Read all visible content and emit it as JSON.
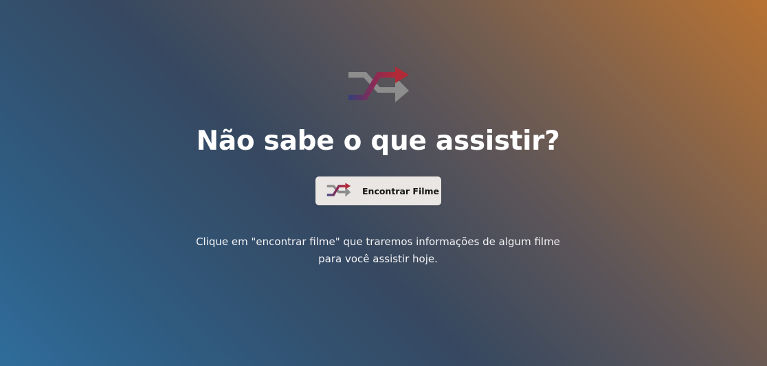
{
  "hero": {
    "title": "Não sabe o que assistir?",
    "description": "Clique em \"encontrar filme\" que traremos informações de algum filme para você assistir hoje.",
    "logo_icon": "shuffle-icon"
  },
  "action": {
    "button_label": "Encontrar Filme",
    "button_icon": "shuffle-icon"
  },
  "colors": {
    "gradient_warm": "#b77232",
    "gradient_mid": "#364860",
    "gradient_cool": "#2f6d9b",
    "button_background": "#e9e6e3",
    "shuffle_blue": "#343f7a",
    "shuffle_red": "#a82a3a",
    "shuffle_gray": "#8c8c8c"
  }
}
